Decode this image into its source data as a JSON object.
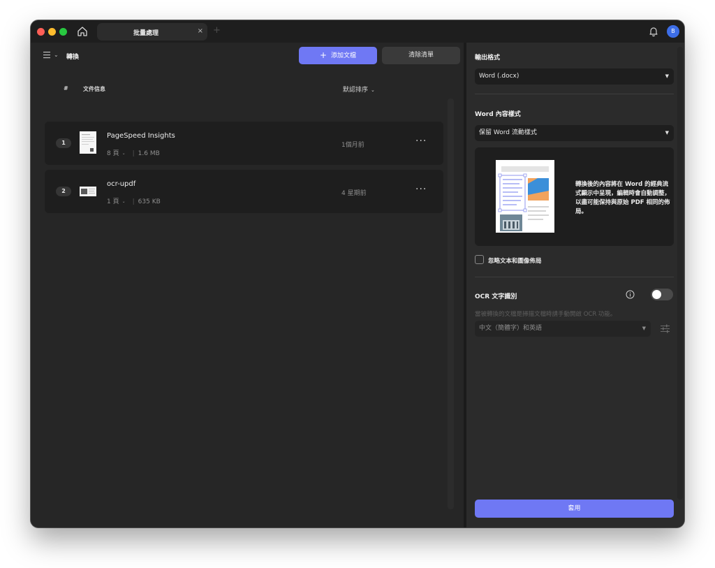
{
  "window": {
    "tab_title": "批量處理",
    "tab_close": "×",
    "tab_add": "+",
    "avatar_initial": "B"
  },
  "left": {
    "title": "轉換",
    "add_files_label": "添加文檔",
    "clear_list_label": "清除清單",
    "col_index": "#",
    "col_file_info": "文件信息",
    "sort_label": "默認排序",
    "files": [
      {
        "index": "1",
        "name": "PageSpeed Insights",
        "pages": "8 頁",
        "size": "1.6 MB",
        "time": "1個月前"
      },
      {
        "index": "2",
        "name": "ocr-updf",
        "pages": "1 頁",
        "size": "635 KB",
        "time": "4 星期前"
      }
    ],
    "more_label": "···"
  },
  "right": {
    "output_format_label": "輸出格式",
    "output_format_value": "Word (.docx)",
    "word_style_label": "Word 內容樣式",
    "word_style_value": "保留 Word 流動樣式",
    "preview_description": "轉換後的內容將在 Word 的經典流式顯示中呈現，編輯時會自動調整，以盡可能保持與原始 PDF 相同的佈局。",
    "ignore_layout_label": "忽略文本和圖像佈局",
    "ignore_layout_checked": false,
    "ocr_label": "OCR 文字識別",
    "ocr_enabled": false,
    "ocr_hint": "當被轉換的文檔是掃描文檔時請手動開啟 OCR 功能。",
    "ocr_language_value": "中文（簡體字）和英語",
    "apply_label": "套用"
  },
  "colors": {
    "accent": "#6f78f4",
    "window_bg": "#262626",
    "panel_bg": "#2b2b2b",
    "row_bg": "#1e1e1e",
    "avatar": "#3d6ee8"
  },
  "icons": [
    "home-icon",
    "bell-icon",
    "menu-icon",
    "chevron-down-icon",
    "plus-icon",
    "more-icon",
    "info-icon",
    "sliders-icon"
  ]
}
